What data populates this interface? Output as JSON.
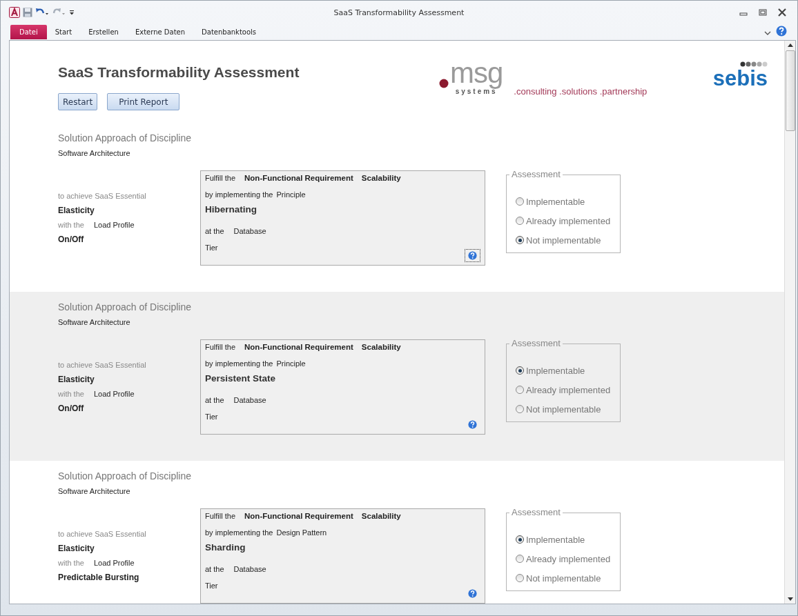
{
  "window": {
    "title": "SaaS Transformability Assessment"
  },
  "ribbon_tabs": [
    {
      "label": "Datei",
      "selected": true
    },
    {
      "label": "Start",
      "selected": false
    },
    {
      "label": "Erstellen",
      "selected": false
    },
    {
      "label": "Externe Daten",
      "selected": false
    },
    {
      "label": "Datenbanktools",
      "selected": false
    }
  ],
  "form": {
    "title": "SaaS Transformability Assessment",
    "buttons": [
      "Restart",
      "Print Report"
    ],
    "logo": {
      "mark": "msg",
      "sub": "systems",
      "slogan": ".consulting .solutions .partnership"
    },
    "partner_logo": "sebis"
  },
  "records": [
    {
      "heading": "Solution Approach of Discipline",
      "discipline": "Software Architecture",
      "essential_label": "to achieve SaaS Essential",
      "essential": "Elasticity",
      "with_label": "with the",
      "profile_label": "Load Profile",
      "profile": "On/Off",
      "fulfill_label": "Fulfill the",
      "requirement_type": "Non-Functional Requirement",
      "requirement": "Scalability",
      "implementing_label": "by implementing the",
      "approach_type": "Principle",
      "approach": "Hibernating",
      "at_label": "at the",
      "layer": "Database",
      "tier_label": "Tier",
      "help_focused": true,
      "assessment_title": "Assessment",
      "options": [
        {
          "label": "Implementable",
          "selected": false
        },
        {
          "label": "Already implemented",
          "selected": false
        },
        {
          "label": "Not implementable",
          "selected": true
        }
      ]
    },
    {
      "heading": "Solution Approach of Discipline",
      "discipline": "Software Architecture",
      "essential_label": "to achieve SaaS Essential",
      "essential": "Elasticity",
      "with_label": "with the",
      "profile_label": "Load Profile",
      "profile": "On/Off",
      "fulfill_label": "Fulfill the",
      "requirement_type": "Non-Functional Requirement",
      "requirement": "Scalability",
      "implementing_label": "by implementing the",
      "approach_type": "Principle",
      "approach": "Persistent State",
      "at_label": "at the",
      "layer": "Database",
      "tier_label": "Tier",
      "help_focused": false,
      "assessment_title": "Assessment",
      "options": [
        {
          "label": "Implementable",
          "selected": true
        },
        {
          "label": "Already implemented",
          "selected": false
        },
        {
          "label": "Not implementable",
          "selected": false
        }
      ]
    },
    {
      "heading": "Solution Approach of Discipline",
      "discipline": "Software Architecture",
      "essential_label": "to achieve SaaS Essential",
      "essential": "Elasticity",
      "with_label": "with the",
      "profile_label": "Load Profile",
      "profile": "Predictable Bursting",
      "fulfill_label": "Fulfill the",
      "requirement_type": "Non-Functional Requirement",
      "requirement": "Scalability",
      "implementing_label": "by implementing the",
      "approach_type": "Design Pattern",
      "approach": "Sharding",
      "at_label": "at the",
      "layer": "Database",
      "tier_label": "Tier",
      "help_focused": false,
      "assessment_title": "Assessment",
      "options": [
        {
          "label": "Implementable",
          "selected": true
        },
        {
          "label": "Already implemented",
          "selected": false
        },
        {
          "label": "Not implementable",
          "selected": false
        }
      ]
    }
  ]
}
